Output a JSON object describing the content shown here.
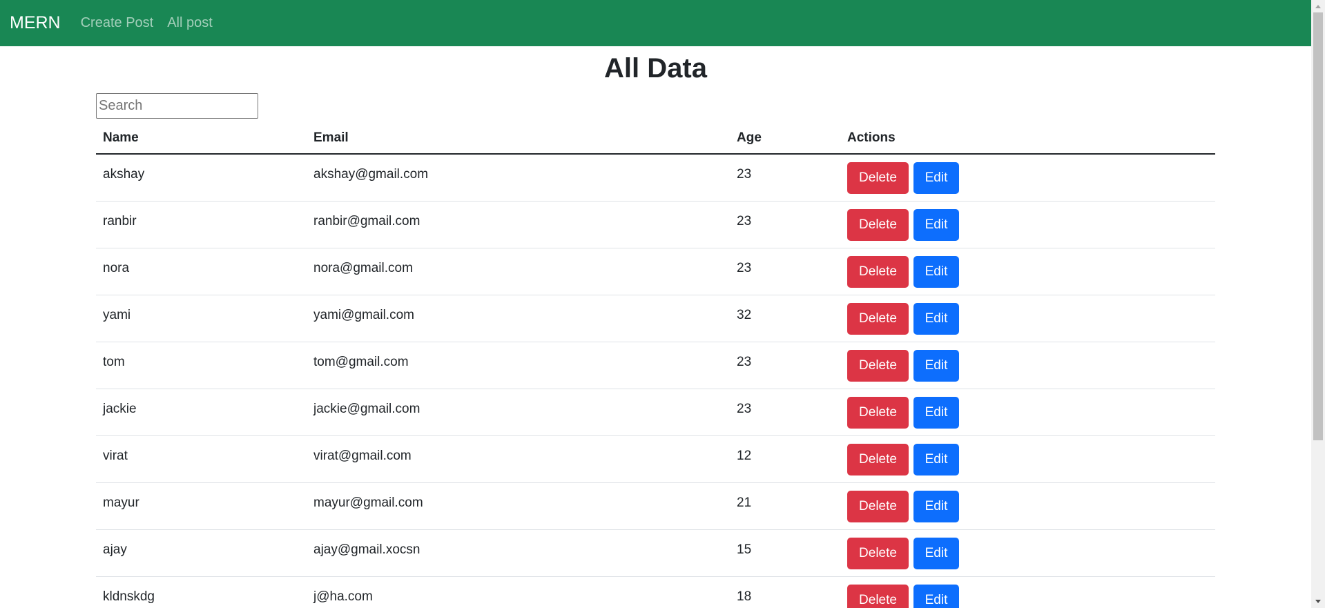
{
  "navbar": {
    "brand": "MERN",
    "links": [
      "Create Post",
      "All post"
    ]
  },
  "page": {
    "title": "All Data"
  },
  "search": {
    "placeholder": "Search",
    "value": ""
  },
  "table": {
    "headers": [
      "Name",
      "Email",
      "Age",
      "Actions"
    ],
    "rows": [
      {
        "name": "akshay",
        "email": "akshay@gmail.com",
        "age": "23"
      },
      {
        "name": "ranbir",
        "email": "ranbir@gmail.com",
        "age": "23"
      },
      {
        "name": "nora",
        "email": "nora@gmail.com",
        "age": "23"
      },
      {
        "name": "yami",
        "email": "yami@gmail.com",
        "age": "32"
      },
      {
        "name": "tom",
        "email": "tom@gmail.com",
        "age": "23"
      },
      {
        "name": "jackie",
        "email": "jackie@gmail.com",
        "age": "23"
      },
      {
        "name": "virat",
        "email": "virat@gmail.com",
        "age": "12"
      },
      {
        "name": "mayur",
        "email": "mayur@gmail.com",
        "age": "21"
      },
      {
        "name": "ajay",
        "email": "ajay@gmail.xocsn",
        "age": "15"
      },
      {
        "name": "kldnskdg",
        "email": "j@ha.com",
        "age": "18"
      }
    ],
    "delete_label": "Delete",
    "edit_label": "Edit"
  },
  "colors": {
    "navbar": "#198754",
    "delete": "#dc3545",
    "edit": "#0d6efd"
  }
}
